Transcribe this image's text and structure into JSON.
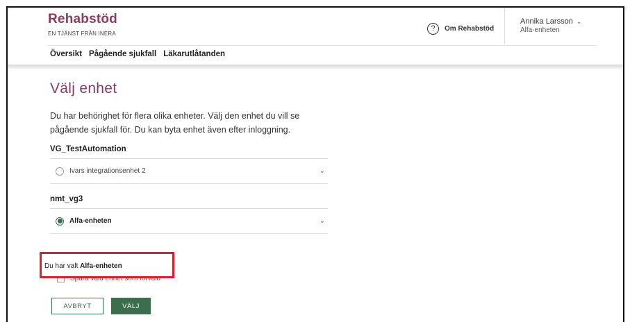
{
  "brand": {
    "title": "Rehabstöd",
    "subtitle": "EN TJÄNST FRÅN INERA"
  },
  "header": {
    "about_icon": "?",
    "about_label": "Om Rehabstöd",
    "user_name": "Annika Larsson",
    "user_chevron": "⌄",
    "user_unit": "Alfa-enheten"
  },
  "nav": {
    "items": [
      {
        "label": "Översikt"
      },
      {
        "label": "Pågående sjukfall"
      },
      {
        "label": "Läkarutlåtanden"
      }
    ]
  },
  "main": {
    "title": "Välj enhet",
    "intro": "Du har behörighet för flera olika enheter. Välj den enhet du vill se pågående sjukfall för. Du kan byta enhet även efter inloggning.",
    "groups": [
      {
        "name": "VG_TestAutomation",
        "option": "Ivars integrationsenhet 2",
        "selected": false
      },
      {
        "name": "nmt_vg3",
        "option": "Alfa-enheten",
        "selected": true
      }
    ],
    "chevron": "⌄",
    "status_prefix": "Du har valt ",
    "status_unit": "Alfa-enheten",
    "remember_label": "Spara vald enhet som förvald",
    "cancel_label": "AVBRYT",
    "confirm_label": "VÄLJ"
  },
  "colors": {
    "brand": "#8c3b5f",
    "primary": "#3c6e4d",
    "highlight": "#e01e2b"
  },
  "icons": {
    "about": "help-circle-icon",
    "chevron": "chevron-down-icon",
    "radio": "radio-icon"
  }
}
